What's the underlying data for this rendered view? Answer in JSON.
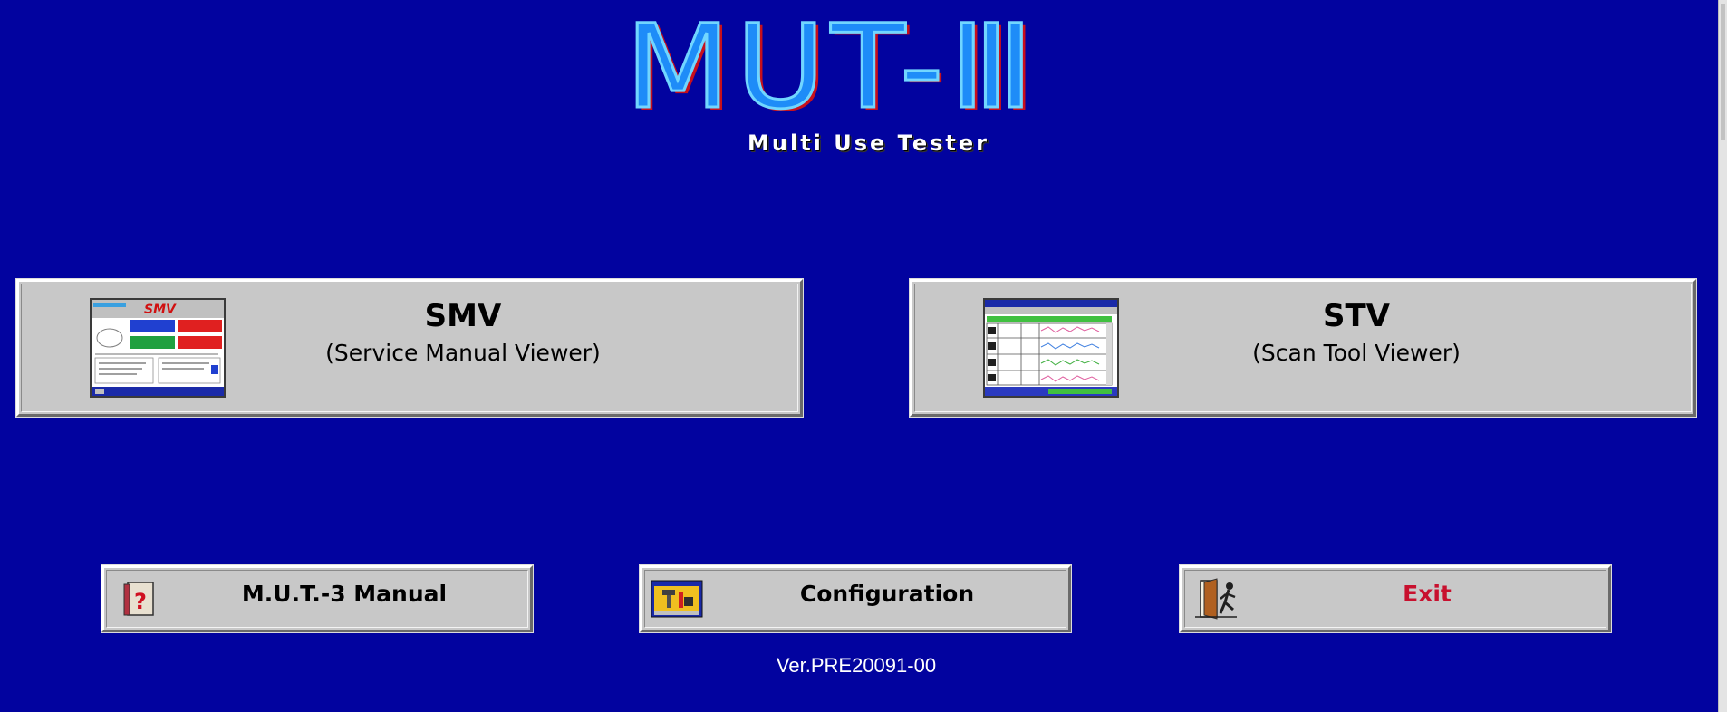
{
  "logo": {
    "title": "MUT-Ⅲ",
    "subtitle": "Multi Use Tester"
  },
  "smv_button": {
    "title": "SMV",
    "subtitle": "(Service Manual Viewer)",
    "thumbnail_text": "SMV"
  },
  "stv_button": {
    "title": "STV",
    "subtitle": "(Scan Tool Viewer)"
  },
  "manual_button": {
    "label": "M.U.T.-3 Manual",
    "icon": "help-book-icon"
  },
  "config_button": {
    "label": "Configuration",
    "icon": "tools-folder-icon"
  },
  "exit_button": {
    "label": "Exit",
    "icon": "exit-door-icon",
    "color": "#c8102e"
  },
  "version": "Ver.PRE20091-00",
  "colors": {
    "background": "#02039f",
    "button_face": "#c8c8c8",
    "logo_blue": "#1e8cf8"
  }
}
